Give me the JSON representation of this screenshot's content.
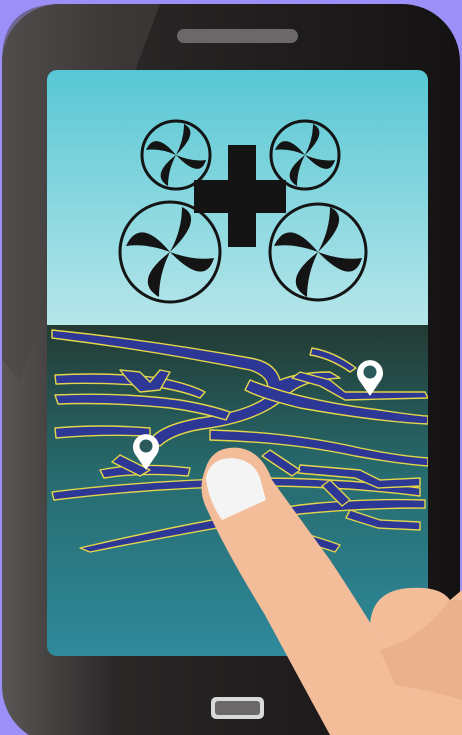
{
  "scene": {
    "subject": "drone-control-on-smartphone",
    "colors": {
      "background": "#9c8ff7",
      "phone_body": "#161414",
      "phone_highlight": "#4a4646",
      "sky_top": "#57c7d4",
      "sky_bottom": "#b6e6ea",
      "drone": "#141414",
      "map_top": "#233a33",
      "map_bottom": "#2f8a9c",
      "roads": "#2d3796",
      "road_outline": "#e4d64a",
      "skin": "#f3bd9a",
      "nail": "#f4f4f4",
      "pin": "#ffffff"
    },
    "map_pins": 2,
    "icons": [
      "drone-icon",
      "map-pin-icon",
      "finger-icon"
    ]
  }
}
